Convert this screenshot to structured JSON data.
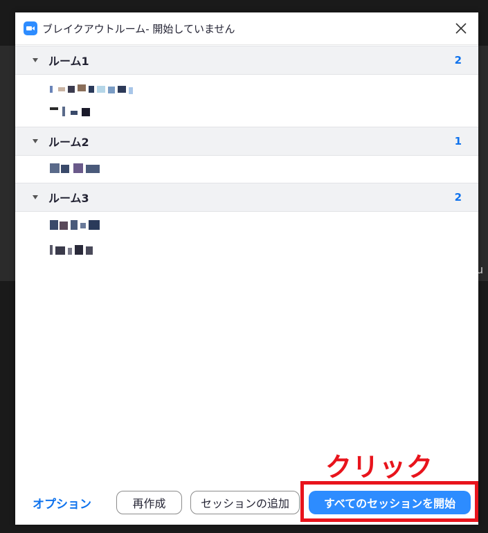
{
  "window": {
    "title": "ブレイクアウトルーム- 開始していません"
  },
  "rooms": [
    {
      "name": "ルーム1",
      "count": "2"
    },
    {
      "name": "ルーム2",
      "count": "1"
    },
    {
      "name": "ルーム3",
      "count": "2"
    }
  ],
  "footer": {
    "options_label": "オプション",
    "recreate_label": "再作成",
    "add_session_label": "セッションの追加",
    "start_all_label": "すべてのセッションを開始"
  },
  "annotation": {
    "text": "クリック"
  },
  "background": {
    "partial_text": "u"
  },
  "colors": {
    "accent": "#2d8cff",
    "link": "#0e72ed",
    "annotation_red": "#e8141c"
  },
  "icons": {
    "app": "zoom-camera-icon",
    "close": "close-icon",
    "room_toggle": "caret-down-icon"
  }
}
